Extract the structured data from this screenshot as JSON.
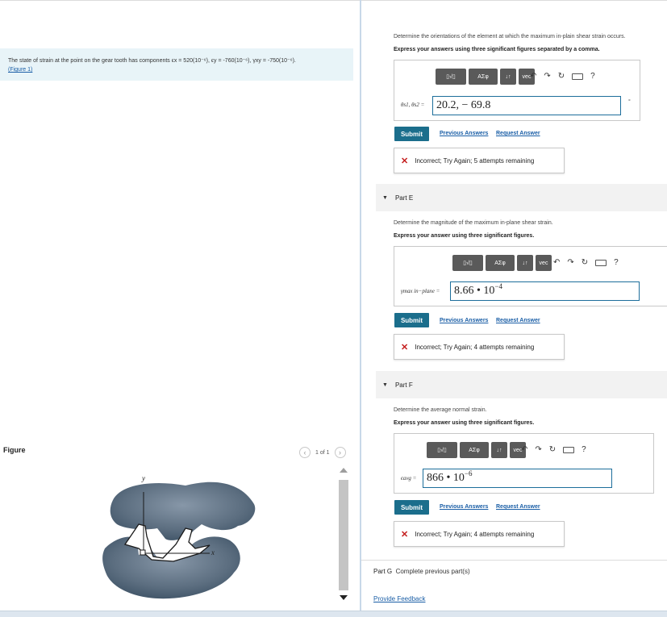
{
  "problem": {
    "text": "The state of strain at the point on the gear tooth has components ϵx = 520(10⁻⁶), ϵy = -760(10⁻⁶), γxy = -750(10⁻⁶).",
    "figure_link": "(Figure 1)"
  },
  "figure_panel": {
    "label": "Figure",
    "page_indicator": "1 of 1",
    "axis_y": "y",
    "axis_x": "x"
  },
  "part_d": {
    "instruction": "Determine the orientations of the element at which the maximum in-plain shear strain occurs.",
    "hint": "Express your answers using three significant figures separated by a comma.",
    "variable": "θs1, θs2 =",
    "answer": "20.2, − 69.8",
    "unit": "°",
    "submit": "Submit",
    "previous_answers": "Previous Answers",
    "request_answer": "Request Answer",
    "feedback": "Incorrect; Try Again; 5 attempts remaining"
  },
  "part_e": {
    "title": "Part E",
    "instruction": "Determine the magnitude of the maximum in-plane shear strain.",
    "hint": "Express your answer using three significant figures.",
    "variable": "γmax in−plane =",
    "answer": "8.66 • 10",
    "exponent": "−4",
    "submit": "Submit",
    "previous_answers": "Previous Answers",
    "request_answer": "Request Answer",
    "feedback": "Incorrect; Try Again; 4 attempts remaining"
  },
  "part_f": {
    "title": "Part F",
    "instruction": "Determine the average normal strain.",
    "hint": "Express your answer using three significant figures.",
    "variable": "ϵavg =",
    "answer": "866 • 10",
    "exponent": "−6",
    "submit": "Submit",
    "previous_answers": "Previous Answers",
    "request_answer": "Request Answer",
    "feedback": "Incorrect; Try Again; 4 attempts remaining"
  },
  "part_g": {
    "title": "Part G",
    "text": "Complete previous part(s)"
  },
  "toolbar": {
    "templates_label": "▯√▯",
    "greek_label": "ΑΣφ",
    "arrows_label": "↓↑",
    "vec_label": "vec",
    "help": "?"
  },
  "footer": {
    "feedback_link": "Provide Feedback"
  },
  "colors": {
    "accent": "#1b6e8c",
    "link": "#1a5ea6",
    "error": "#c41e1e",
    "problem_bg": "#e8f4f8"
  }
}
